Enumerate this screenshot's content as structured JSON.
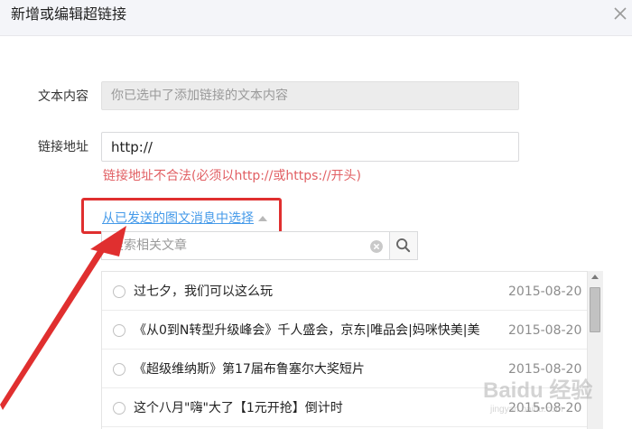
{
  "dialog": {
    "title": "新增或编辑超链接"
  },
  "form": {
    "text_label": "文本内容",
    "text_placeholder": "你已选中了添加链接的文本内容",
    "link_label": "链接地址",
    "link_value": "http://",
    "error": "链接地址不合法(必须以http://或https://开头)"
  },
  "selector": {
    "link_text": "从已发送的图文消息中选择",
    "search_placeholder": "搜索相关文章"
  },
  "articles": [
    {
      "title": "过七夕，我们可以这么玩",
      "date": "2015-08-20"
    },
    {
      "title": "《从0到N转型升级峰会》千人盛会，京东|唯品会|妈咪快美|美...",
      "date": "2015-08-20"
    },
    {
      "title": "《超级维纳斯》第17届布鲁塞尔大奖短片",
      "date": "2015-08-20"
    },
    {
      "title": "这个八月\"嗨\"大了【1元开抢】倒计时",
      "date": "2015-08-20"
    }
  ],
  "watermark": {
    "text": "Baidu 经验",
    "url": "jingyan.baidu.com"
  },
  "colors": {
    "error": "#e15f63",
    "link": "#459ae9",
    "annotation": "#e02f2f"
  }
}
